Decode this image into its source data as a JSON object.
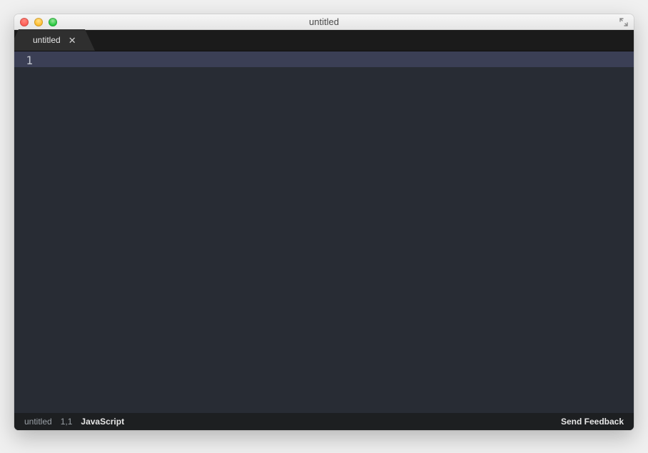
{
  "window": {
    "title": "untitled"
  },
  "tabs": [
    {
      "label": "untitled"
    }
  ],
  "editor": {
    "gutter_lines": [
      "1"
    ]
  },
  "status": {
    "filename": "untitled",
    "cursor": "1,1",
    "language": "JavaScript",
    "feedback_label": "Send Feedback"
  }
}
